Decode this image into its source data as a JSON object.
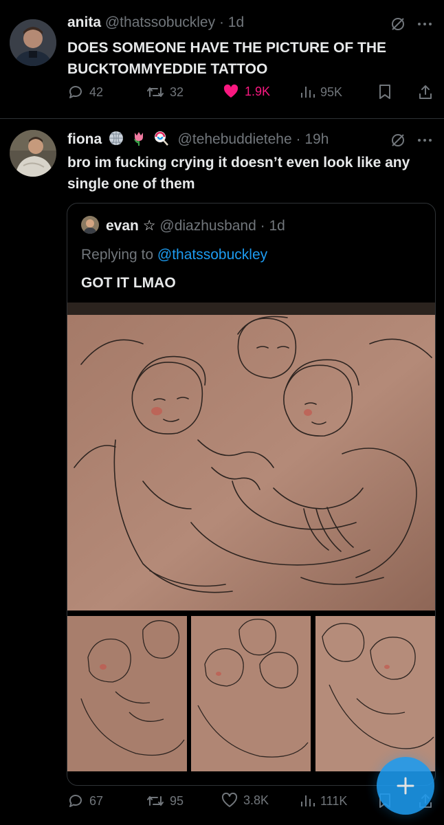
{
  "tweet1": {
    "name": "anita",
    "handle": "@thatssobuckley",
    "sep": "·",
    "time": "1d",
    "text": "DOES SOMEONE HAVE THE PICTURE OF THE BUCKTOMMYEDDIE TATTOO",
    "stats": {
      "replies": "42",
      "retweets": "32",
      "likes": "1.9K",
      "views": "95K"
    }
  },
  "tweet2": {
    "name": "fiona",
    "emojis": [
      "mirror-ball",
      "tulip",
      "lollipop"
    ],
    "handle": "@tehebuddietehe",
    "sep": "·",
    "time": "19h",
    "text": "bro im fucking crying it doesn’t even look like any single one of them",
    "quote": {
      "name": "evan ☆",
      "handle": "@diazhusband",
      "sep": "·",
      "time": "1d",
      "replying_prefix": "Replying to",
      "replying_handle": "@thatssobuckley",
      "text": "GOT IT LMAO",
      "media": [
        "tattoo-photo-main",
        "tattoo-photo-1",
        "tattoo-photo-2",
        "tattoo-photo-3"
      ]
    },
    "stats": {
      "replies": "67",
      "retweets": "95",
      "likes": "3.8K",
      "views": "111K"
    }
  },
  "colors": {
    "background": "#000000",
    "text_primary": "#e7e9ea",
    "text_secondary": "#71767b",
    "accent": "#1d9bf0",
    "like_active": "#f91880",
    "divider": "#2f3336"
  },
  "icons": [
    "reply-icon",
    "retweet-icon",
    "like-icon",
    "views-icon",
    "bookmark-icon",
    "share-icon",
    "muted-icon",
    "more-icon",
    "compose-plus-icon"
  ]
}
